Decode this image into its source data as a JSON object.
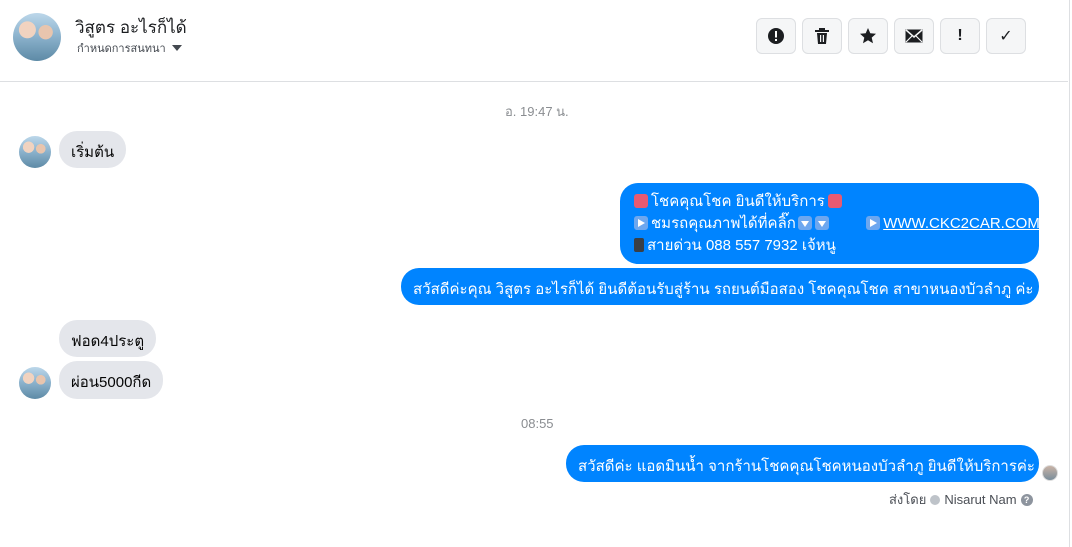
{
  "header": {
    "contact_name": "วิสูตร อะไรก็ได้",
    "assign_label": "กำหนดการสนทนา",
    "toolbar": [
      {
        "name": "report-spam-button",
        "icon": "exclamation-circle-icon"
      },
      {
        "name": "delete-button",
        "icon": "trash-icon"
      },
      {
        "name": "star-button",
        "icon": "star-icon"
      },
      {
        "name": "mark-unread-button",
        "icon": "envelope-icon"
      },
      {
        "name": "follow-up-button",
        "icon": "exclamation-icon",
        "glyph": "!"
      },
      {
        "name": "mark-done-button",
        "icon": "check-icon",
        "glyph": "✓"
      }
    ]
  },
  "conversation": {
    "timestamp_1": "อ. 19:47 น.",
    "msg_in_1": "เริ่มต้น",
    "msg_out_1": {
      "line1": "โชคคุณโชค ยินดีให้บริการ",
      "line2a": "ชมรถคุณภาพได้ที่คลิ๊ก",
      "line2b": "WWW.CKC2CAR.COM",
      "line3": "สายด่วน 088 557 7932 เจ้หนู"
    },
    "msg_out_2": "สวัสดีค่ะคุณ วิสูตร อะไรก็ได้ ยินดีต้อนรับสู่ร้าน รถยนต์มือสอง โชคคุณโชค สาขาหนองบัวลำภู ค่ะ",
    "msg_in_2": "ฟอด4ประตู",
    "msg_in_3": "ผ่อน5000กีด",
    "timestamp_2": "08:55",
    "msg_out_3": "สวัสดีค่ะ แอดมินน้ำ จากร้านโชคคุณโชคหนองบัวลำภู ยินดีให้บริการค่ะ",
    "sent_by_label": "ส่งโดย",
    "sent_by_name": "Nisarut Nam"
  },
  "colors": {
    "outgoing_bubble": "#0084ff",
    "incoming_bubble": "#e4e6eb"
  }
}
